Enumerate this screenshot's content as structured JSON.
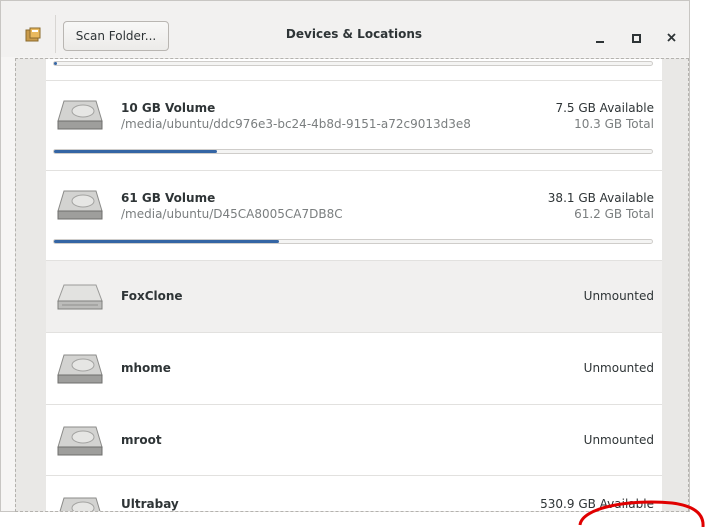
{
  "window": {
    "title": "Devices & Locations",
    "scan_button_label": "Scan Folder...",
    "icons": [
      "app-icon",
      "minimize-icon",
      "maximize-icon",
      "close-icon"
    ]
  },
  "volumes": [
    {
      "name": "",
      "path": "",
      "available": "",
      "total": "",
      "usage": 0.005
    },
    {
      "name": "10 GB Volume",
      "path": "/media/ubuntu/ddc976e3-bc24-4b8d-9151-a72c9013d3e8",
      "available": "7.5 GB Available",
      "total": "10.3 GB Total",
      "usage": 0.273
    },
    {
      "name": "61 GB Volume",
      "path": "/media/ubuntu/D45CA8005CA7DB8C",
      "available": "38.1 GB Available",
      "total": "61.2 GB Total",
      "usage": 0.377
    },
    {
      "name": "FoxClone",
      "status": "Unmounted"
    },
    {
      "name": "mhome",
      "status": "Unmounted"
    },
    {
      "name": "mroot",
      "status": "Unmounted"
    },
    {
      "name": "Ultrabay",
      "available": "530.9 GB Available"
    }
  ],
  "colors": {
    "progress_fill": "#3465a4",
    "annotation": "#e00000"
  }
}
